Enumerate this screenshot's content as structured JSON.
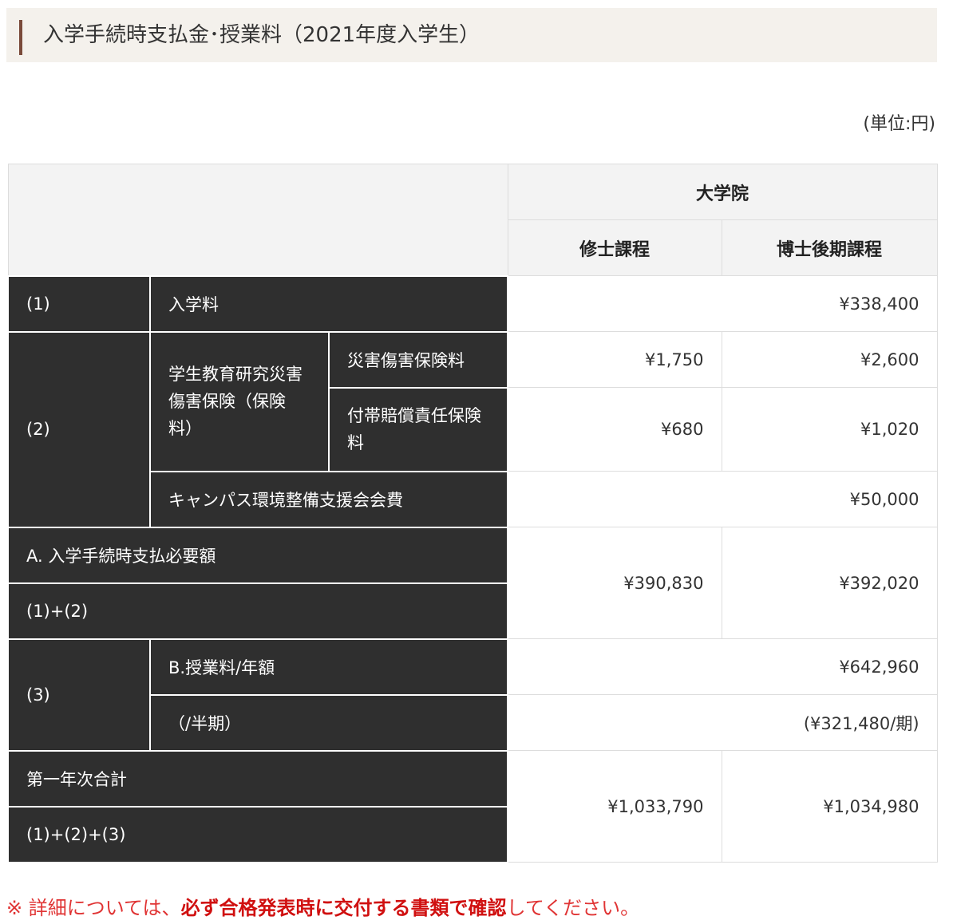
{
  "heading": {
    "title": "入学手続時支払金･授業料（2021年度入学生）"
  },
  "unit_label": "(単位:円)",
  "table": {
    "header": {
      "graduate": "大学院",
      "master": "修士課程",
      "doctor": "博士後期課程"
    },
    "row1": {
      "num": "(1)",
      "label": "入学料",
      "value": "¥338,400"
    },
    "row2": {
      "num": "(2)",
      "group_label": "学生教育研究災害傷害保険（保険料）",
      "disaster_label": "災害傷害保険料",
      "disaster_master": "¥1,750",
      "disaster_doctor": "¥2,600",
      "liability_label": "付帯賠償責任保険料",
      "liability_master": "¥680",
      "liability_doctor": "¥1,020",
      "campus_label": "キャンパス環境整備支援会会費",
      "campus_value": "¥50,000"
    },
    "rowA": {
      "label": "A. 入学手続時支払必要額",
      "formula": "(1)+(2)",
      "master": "¥390,830",
      "doctor": "¥392,020"
    },
    "row3": {
      "num": "(3)",
      "annual_label": "B.授業料/年額",
      "annual_value": "¥642,960",
      "half_label": "（/半期）",
      "half_value": "(¥321,480/期)"
    },
    "rowTotal": {
      "label": "第一年次合計",
      "formula": "(1)+(2)+(3)",
      "master": "¥1,033,790",
      "doctor": "¥1,034,980"
    }
  },
  "note": {
    "mark": "※",
    "prefix": "詳細については、",
    "emphasis": "必ず合格発表時に交付する書類で確認",
    "suffix": "してください。"
  }
}
